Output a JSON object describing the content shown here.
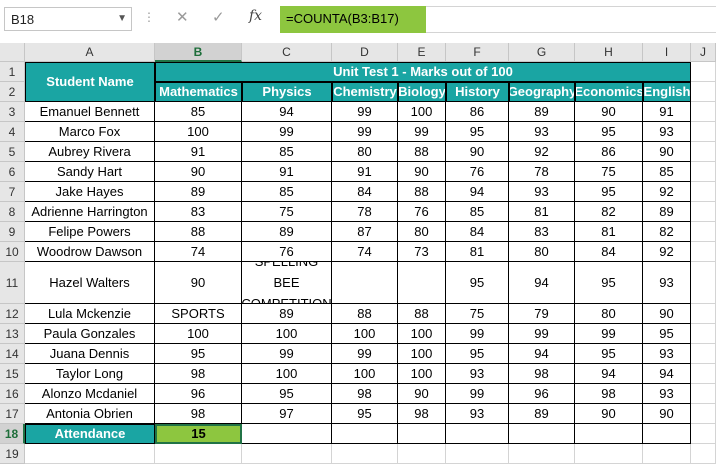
{
  "name_box": {
    "value": "B18"
  },
  "formula_bar": {
    "fx_label": "fx",
    "formula": "=COUNTA(B3:B17)"
  },
  "columns": [
    "A",
    "B",
    "C",
    "D",
    "E",
    "F",
    "G",
    "H",
    "I",
    "J"
  ],
  "rows": [
    "1",
    "2",
    "3",
    "4",
    "5",
    "6",
    "7",
    "8",
    "9",
    "10",
    "11",
    "12",
    "13",
    "14",
    "15",
    "16",
    "17",
    "18",
    "19"
  ],
  "header": {
    "student_name": "Student Name",
    "unit_test": "Unit Test 1 - Marks out of 100"
  },
  "subjects": [
    "Mathematics",
    "Physics",
    "Chemistry",
    "Biology",
    "History",
    "Geography",
    "Economics",
    "English"
  ],
  "students": [
    {
      "name": "Emanuel Bennett",
      "marks": [
        "85",
        "94",
        "99",
        "100",
        "86",
        "89",
        "90",
        "91"
      ]
    },
    {
      "name": "Marco Fox",
      "marks": [
        "100",
        "99",
        "99",
        "99",
        "95",
        "93",
        "95",
        "93"
      ]
    },
    {
      "name": "Aubrey Rivera",
      "marks": [
        "91",
        "85",
        "80",
        "88",
        "90",
        "92",
        "86",
        "90"
      ]
    },
    {
      "name": "Sandy Hart",
      "marks": [
        "90",
        "91",
        "91",
        "90",
        "76",
        "78",
        "75",
        "85"
      ]
    },
    {
      "name": "Jake Hayes",
      "marks": [
        "89",
        "85",
        "84",
        "88",
        "94",
        "93",
        "95",
        "92"
      ]
    },
    {
      "name": "Adrienne Harrington",
      "marks": [
        "83",
        "75",
        "78",
        "76",
        "85",
        "81",
        "82",
        "89"
      ]
    },
    {
      "name": "Felipe Powers",
      "marks": [
        "88",
        "89",
        "87",
        "80",
        "84",
        "83",
        "81",
        "82"
      ]
    },
    {
      "name": "Woodrow Dawson",
      "marks": [
        "74",
        "76",
        "74",
        "73",
        "81",
        "80",
        "84",
        "92"
      ]
    },
    {
      "name": "Hazel Walters",
      "marks": [
        "90",
        "SPELLING BEE COMPETITION",
        "",
        "",
        "95",
        "94",
        "95",
        "93"
      ]
    },
    {
      "name": "Lula Mckenzie",
      "marks": [
        "SPORTS",
        "89",
        "88",
        "88",
        "75",
        "79",
        "80",
        "90"
      ]
    },
    {
      "name": "Paula Gonzales",
      "marks": [
        "100",
        "100",
        "100",
        "100",
        "99",
        "99",
        "99",
        "95"
      ]
    },
    {
      "name": "Juana Dennis",
      "marks": [
        "95",
        "99",
        "99",
        "100",
        "95",
        "94",
        "95",
        "93"
      ]
    },
    {
      "name": "Taylor Long",
      "marks": [
        "98",
        "100",
        "100",
        "100",
        "93",
        "98",
        "94",
        "94"
      ]
    },
    {
      "name": "Alonzo Mcdaniel",
      "marks": [
        "96",
        "95",
        "98",
        "90",
        "99",
        "96",
        "98",
        "93"
      ]
    },
    {
      "name": "Antonia Obrien",
      "marks": [
        "98",
        "97",
        "95",
        "98",
        "93",
        "89",
        "90",
        "90"
      ]
    }
  ],
  "attendance": {
    "label": "Attendance",
    "value": "15"
  }
}
